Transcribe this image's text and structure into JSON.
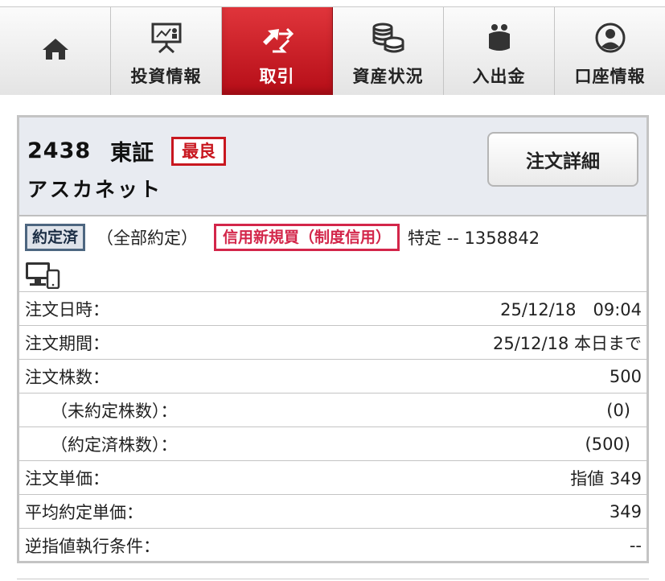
{
  "nav": {
    "items": [
      {
        "label": "",
        "icon": "home-icon"
      },
      {
        "label": "投資情報",
        "icon": "presentation-board-icon"
      },
      {
        "label": "取引",
        "icon": "trade-arrows-icon",
        "active": true
      },
      {
        "label": "資産状況",
        "icon": "coins-stack-icon"
      },
      {
        "label": "入出金",
        "icon": "coin-purse-icon"
      },
      {
        "label": "口座情報",
        "icon": "user-circle-icon"
      }
    ]
  },
  "order": {
    "code": "2438",
    "market": "東証",
    "price_type_badge": "最良",
    "name": "アスカネット",
    "detail_button": "注文詳細",
    "status_badge": "約定済",
    "status_note": "（全部約定）",
    "trade_type_badge": "信用新規買（制度信用）",
    "account_info": "特定 -- 1358842",
    "device_icon": "pc-smartphone-icon"
  },
  "rows": [
    {
      "label": "注文日時：",
      "value": "25/12/18　09:04"
    },
    {
      "label": "注文期間：",
      "value": "25/12/18 本日まで"
    },
    {
      "label": "注文株数：",
      "value": "500"
    },
    {
      "label": "（未約定株数）：",
      "value": "(0)"
    },
    {
      "label": "（約定済株数）：",
      "value": "(500)"
    },
    {
      "label": "注文単価：",
      "value": "指値 349"
    },
    {
      "label": "平均約定単価：",
      "value": "349"
    },
    {
      "label": "逆指値執行条件：",
      "value": "--"
    }
  ],
  "colors": {
    "active_tab": "#c8171f",
    "best_badge": "#c8171f",
    "credit_badge": "#d3264a",
    "done_badge_border": "#4d6680",
    "header_bg": "#e8ebf1"
  }
}
